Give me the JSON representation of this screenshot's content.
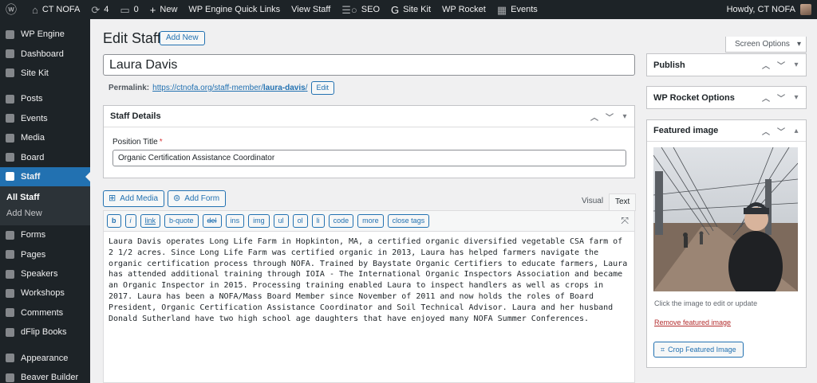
{
  "adminbar": {
    "site_name": "CT NOFA",
    "updates_count": "4",
    "comments_count": "0",
    "new_label": "New",
    "wp_engine_label": "WP Engine Quick Links",
    "view_label": "View Staff",
    "seo_label": "SEO",
    "sitekit_label": "Site Kit",
    "rocket_label": "WP Rocket",
    "events_label": "Events",
    "howdy": "Howdy, CT NOFA"
  },
  "menu": {
    "wp_engine": "WP Engine",
    "dashboard": "Dashboard",
    "site_kit": "Site Kit",
    "posts": "Posts",
    "events": "Events",
    "media": "Media",
    "board": "Board",
    "staff": "Staff",
    "all_staff": "All Staff",
    "add_new": "Add New",
    "forms": "Forms",
    "pages": "Pages",
    "speakers": "Speakers",
    "workshops": "Workshops",
    "comments": "Comments",
    "dflip": "dFlip Books",
    "appearance": "Appearance",
    "beaver": "Beaver Builder"
  },
  "page": {
    "title": "Edit Staff",
    "add_new": "Add New",
    "screen_options": "Screen Options",
    "post_title": "Laura Davis",
    "permalink_label": "Permalink:",
    "permalink_base": "https://ctnofa.org/staff-member/",
    "permalink_slug": "laura-davis",
    "permalink_tail": "/",
    "edit_btn": "Edit"
  },
  "staff_details": {
    "heading": "Staff Details",
    "position_label": "Position Title",
    "required_mark": "*",
    "position_value": "Organic Certification Assistance Coordinator"
  },
  "editor": {
    "add_media": "Add Media",
    "add_form": "Add Form",
    "tab_visual": "Visual",
    "tab_text": "Text",
    "buttons": [
      "b",
      "i",
      "link",
      "b-quote",
      "del",
      "ins",
      "img",
      "ul",
      "ol",
      "li",
      "code",
      "more",
      "close tags"
    ],
    "content": "Laura Davis operates Long Life Farm in Hopkinton, MA, a certified organic diversified vegetable CSA farm of 2 1/2 acres. Since Long Life Farm was certified organic in 2013, Laura has helped farmers navigate the organic certification process through NOFA. Trained by Baystate Organic Certifiers to educate farmers, Laura has attended additional training through IOIA - The International Organic Inspectors Association and became an Organic Inspector in 2015. Processing training enabled Laura to inspect handlers as well as crops in 2017. Laura has been a NOFA/Mass Board Member since November of 2011 and now holds the roles of Board President, Organic Certification Assistance Coordinator and Soil Technical Advisor. Laura and her husband Donald Sutherland have two high school age daughters that have enjoyed many NOFA Summer Conferences."
  },
  "sidebar": {
    "publish": "Publish",
    "rocket": "WP Rocket Options",
    "featured": "Featured image",
    "caption": "Click the image to edit or update",
    "remove": "Remove featured image",
    "crop": "Crop Featured Image"
  },
  "colors": {
    "admin_dark": "#1d2327",
    "accent": "#2271b1",
    "danger": "#b32d2e"
  }
}
